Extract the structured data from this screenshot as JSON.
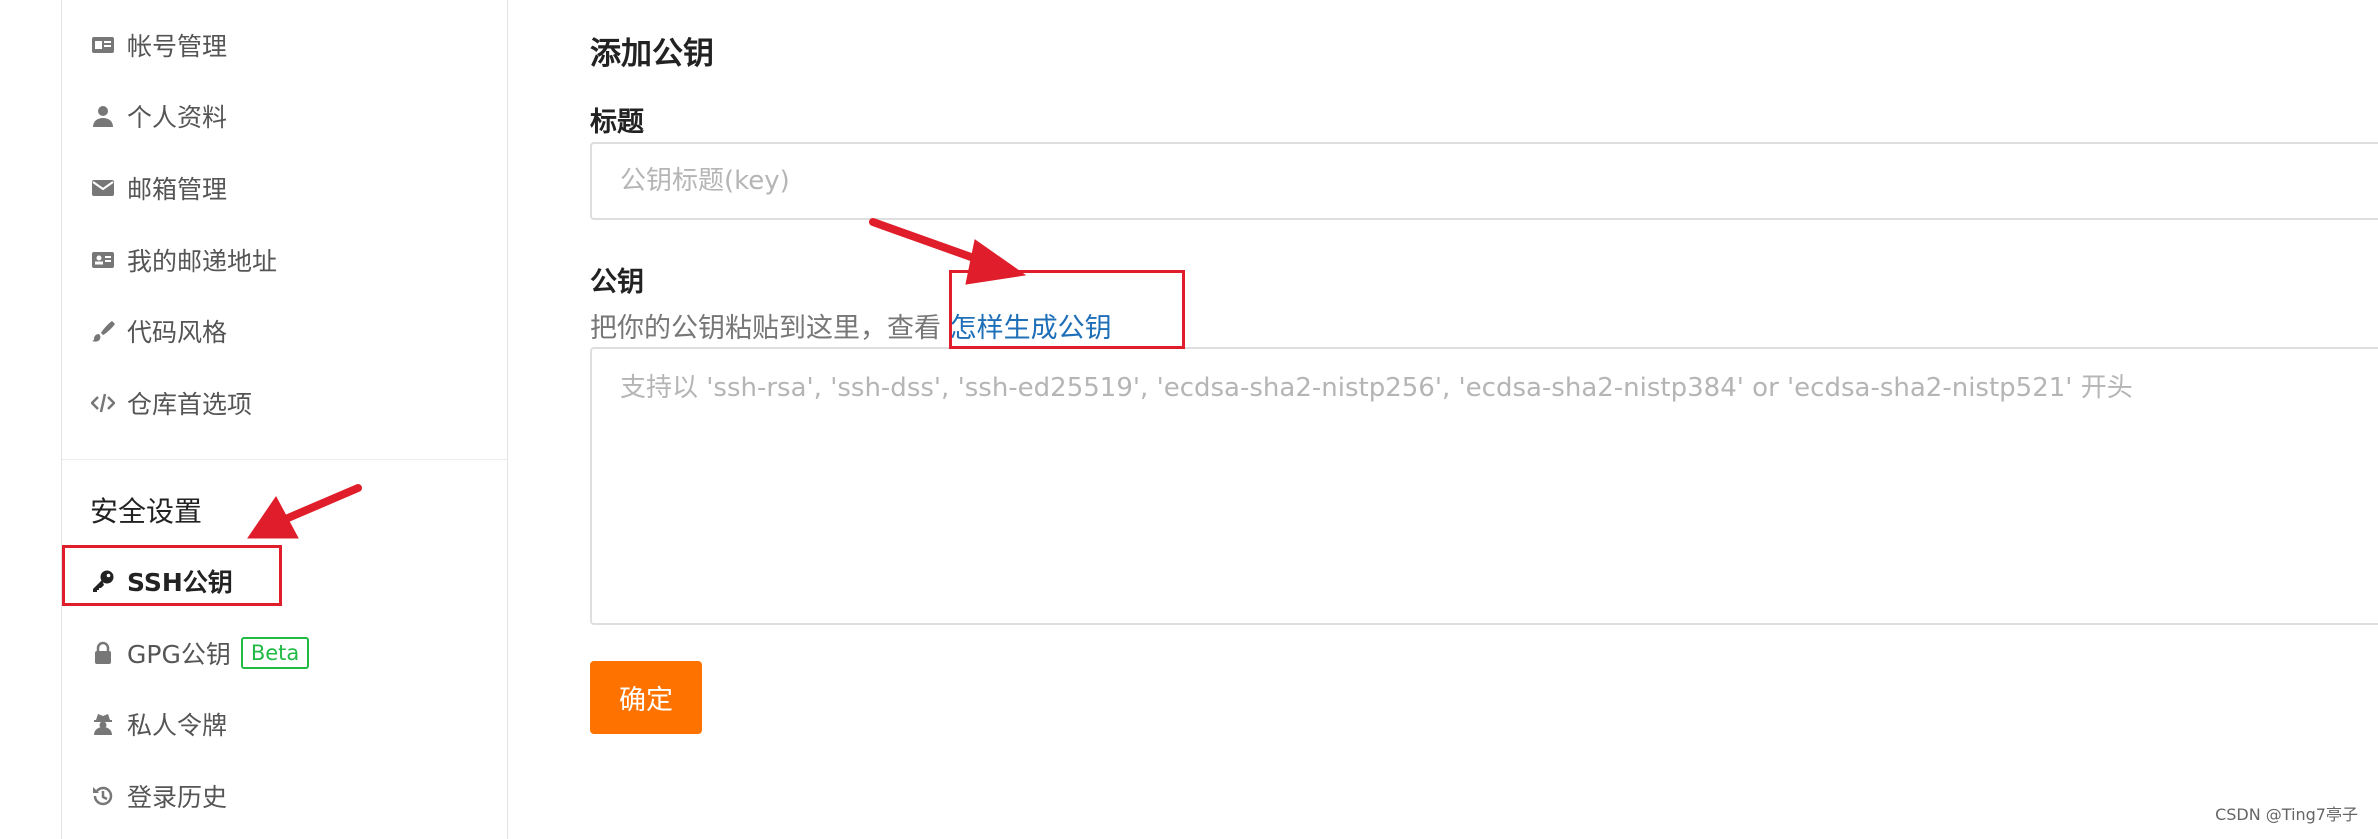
{
  "sidebar": {
    "items": [
      {
        "label": "帐号管理",
        "icon": "id-card-icon"
      },
      {
        "label": "个人资料",
        "icon": "user-icon"
      },
      {
        "label": "邮箱管理",
        "icon": "envelope-icon"
      },
      {
        "label": "我的邮递地址",
        "icon": "address-card-icon"
      },
      {
        "label": "代码风格",
        "icon": "paint-brush-icon"
      },
      {
        "label": "仓库首选项",
        "icon": "code-icon"
      }
    ],
    "section_title": "安全设置",
    "security_items": [
      {
        "label": "SSH公钥",
        "icon": "key-icon",
        "active": true
      },
      {
        "label": "GPG公钥",
        "icon": "lock-icon",
        "badge": "Beta"
      },
      {
        "label": "私人令牌",
        "icon": "user-secret-icon"
      },
      {
        "label": "登录历史",
        "icon": "history-icon"
      }
    ]
  },
  "main": {
    "heading": "添加公钥",
    "title_label": "标题",
    "title_placeholder": "公钥标题(key)",
    "key_label": "公钥",
    "hint_text": "把你的公钥粘贴到这里，查看",
    "hint_link": "怎样生成公钥",
    "key_placeholder": "支持以 'ssh-rsa', 'ssh-dss', 'ssh-ed25519', 'ecdsa-sha2-nistp256', 'ecdsa-sha2-nistp384' or 'ecdsa-sha2-nistp521' 开头",
    "submit_label": "确定"
  },
  "annotations": {
    "highlight_color": "#e01e2b"
  },
  "watermark": "CSDN @Ting7亭子"
}
